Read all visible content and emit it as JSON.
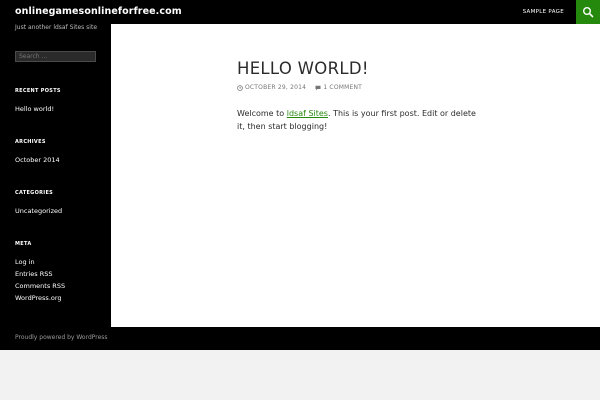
{
  "header": {
    "site_title": "onlinegamesonlineforfree.com",
    "nav": {
      "sample_page": "SAMPLE PAGE"
    },
    "search_icon": "search-icon"
  },
  "sidebar": {
    "tagline": "Just another ldsaf Sites site",
    "search_placeholder": "Search …",
    "recent_posts": {
      "title": "RECENT POSTS",
      "items": [
        "Hello world!"
      ]
    },
    "archives": {
      "title": "ARCHIVES",
      "items": [
        "October 2014"
      ]
    },
    "categories": {
      "title": "CATEGORIES",
      "items": [
        "Uncategorized"
      ]
    },
    "meta": {
      "title": "META",
      "items": [
        "Log in",
        "Entries RSS",
        "Comments RSS",
        "WordPress.org"
      ]
    }
  },
  "post": {
    "title": "HELLO WORLD!",
    "date": "OCTOBER 29, 2014",
    "comments": "1 COMMENT",
    "body_prefix": "Welcome to ",
    "body_link": "ldsaf Sites",
    "body_suffix": ". This is your first post. Edit or delete it, then start blogging!"
  },
  "footer": {
    "credit": "Proudly powered by WordPress"
  },
  "colors": {
    "accent": "#24890d",
    "header_bg": "#000000",
    "page_bg": "#f2f2f2"
  }
}
